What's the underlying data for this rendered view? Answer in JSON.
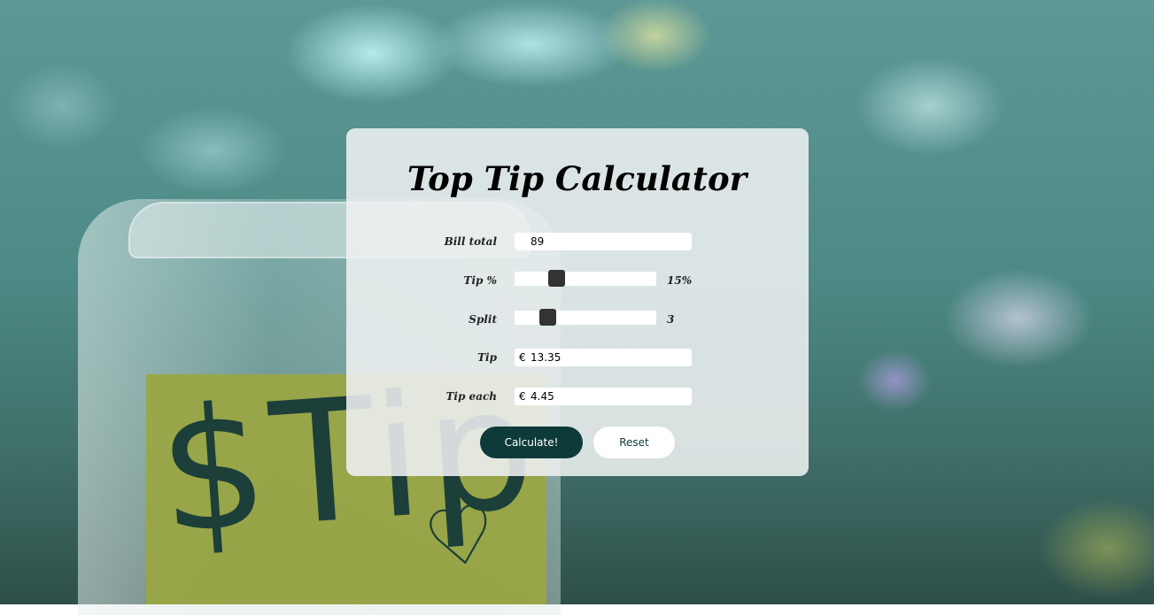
{
  "title": "Top Tip Calculator",
  "fields": {
    "bill_label": "Bill total",
    "bill_value": "89",
    "tip_percent_label": "Tip %",
    "tip_percent_value": 15,
    "tip_percent_display": "15%",
    "split_label": "Split",
    "split_value": 3,
    "split_display": "3",
    "tip_label": "Tip",
    "tip_currency": "€",
    "tip_value": "13.35",
    "tip_each_label": "Tip each",
    "tip_each_currency": "€",
    "tip_each_value": "4.45"
  },
  "buttons": {
    "calculate": "Calculate!",
    "reset": "Reset"
  },
  "colors": {
    "primary": "#0d3b3a",
    "thumb": "#333333"
  }
}
